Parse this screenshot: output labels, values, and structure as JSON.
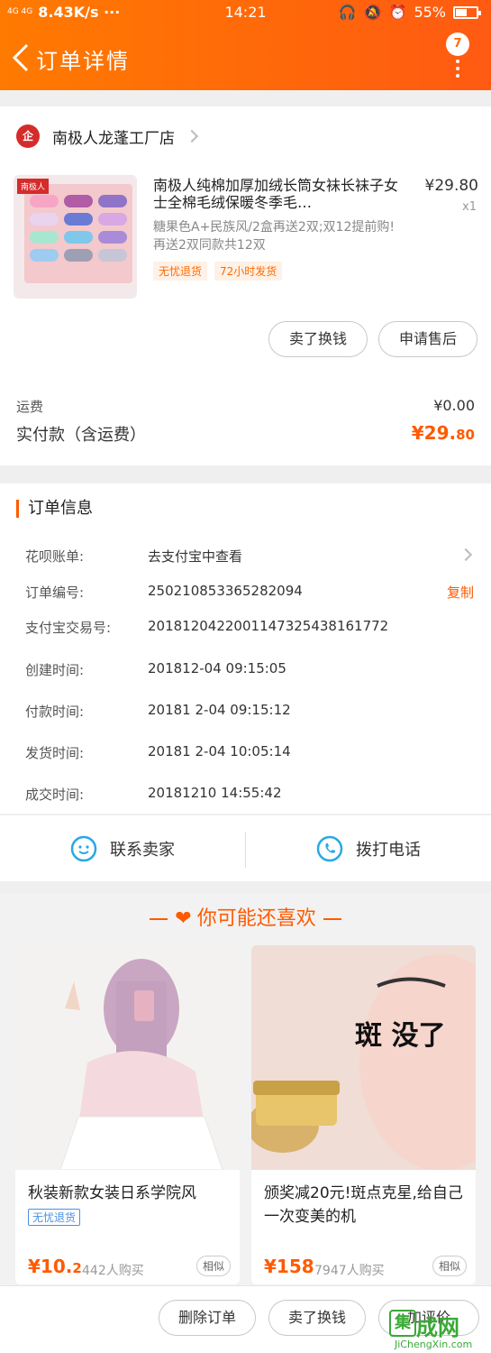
{
  "status_bar": {
    "network": "4G 4G",
    "speed": "8.43K/s ···",
    "time": "14:21",
    "battery": "55%"
  },
  "header": {
    "title": "订单详情",
    "badge": "7"
  },
  "shop": {
    "logo": "企",
    "name": "南极人龙蓬工厂店",
    "product": {
      "brand": "南极人",
      "title": "南极人纯棉加厚加绒长筒女袜长袜子女士全棉毛绒保暖冬季毛…",
      "spec": "糖果色A+民族风/2盒再送2双;双12提前购! 再送2双同款共12双",
      "tags": [
        "无忧退货",
        "72小时发货"
      ],
      "price": "¥29.80",
      "qty": "x1"
    },
    "actions": [
      "卖了换钱",
      "申请售后"
    ],
    "fee_label": "运费",
    "fee_value": "¥0.00",
    "paid_label": "实付款（含运费）",
    "paid_value_main": "¥29.",
    "paid_value_cents": "80"
  },
  "order_info": {
    "title": "订单信息",
    "rows": [
      {
        "key": "花呗账单:",
        "value": "去支付宝中查看",
        "action": ""
      },
      {
        "key": "订单编号:",
        "value": "250210853365282094",
        "action": "复制"
      },
      {
        "key": "支付宝交易号:",
        "value": "2018120422001147325438161772",
        "action": ""
      },
      {
        "key": "创建时间:",
        "value": "201812-04 09:15:05",
        "action": ""
      },
      {
        "key": "付款时间:",
        "value": "20181 2-04 09:15:12",
        "action": ""
      },
      {
        "key": "发货时间:",
        "value": "20181 2-04 10:05:14",
        "action": ""
      },
      {
        "key": "成交时间:",
        "value": "20181210 14:55:42",
        "action": ""
      }
    ]
  },
  "contact": {
    "seller": "联系卖家",
    "phone": "拨打电话"
  },
  "recommend": {
    "title": "你可能还喜欢",
    "items": [
      {
        "title": "秋装新款女装日系学院风",
        "tag": "无忧退货",
        "price_main": "¥10.",
        "price_cents": "2",
        "sold": "442人购买",
        "similar": "相似"
      },
      {
        "title": "颁奖减20元!斑点克星,给自己一次变美的机",
        "overlay": "斑 没了",
        "price_main": "¥158",
        "price_cents": "",
        "sold": "7947人购买",
        "similar": "相似"
      }
    ]
  },
  "bottom_bar": {
    "delete": "删除订单",
    "sell": "卖了换钱",
    "review": "加评价"
  },
  "watermark": {
    "mark": "集",
    "text": "成网",
    "url": "JiChengXin.com"
  },
  "colors": {
    "accent": "#ff5a00",
    "header_start": "#ff7a00",
    "link_blue": "#2aa8e6"
  }
}
